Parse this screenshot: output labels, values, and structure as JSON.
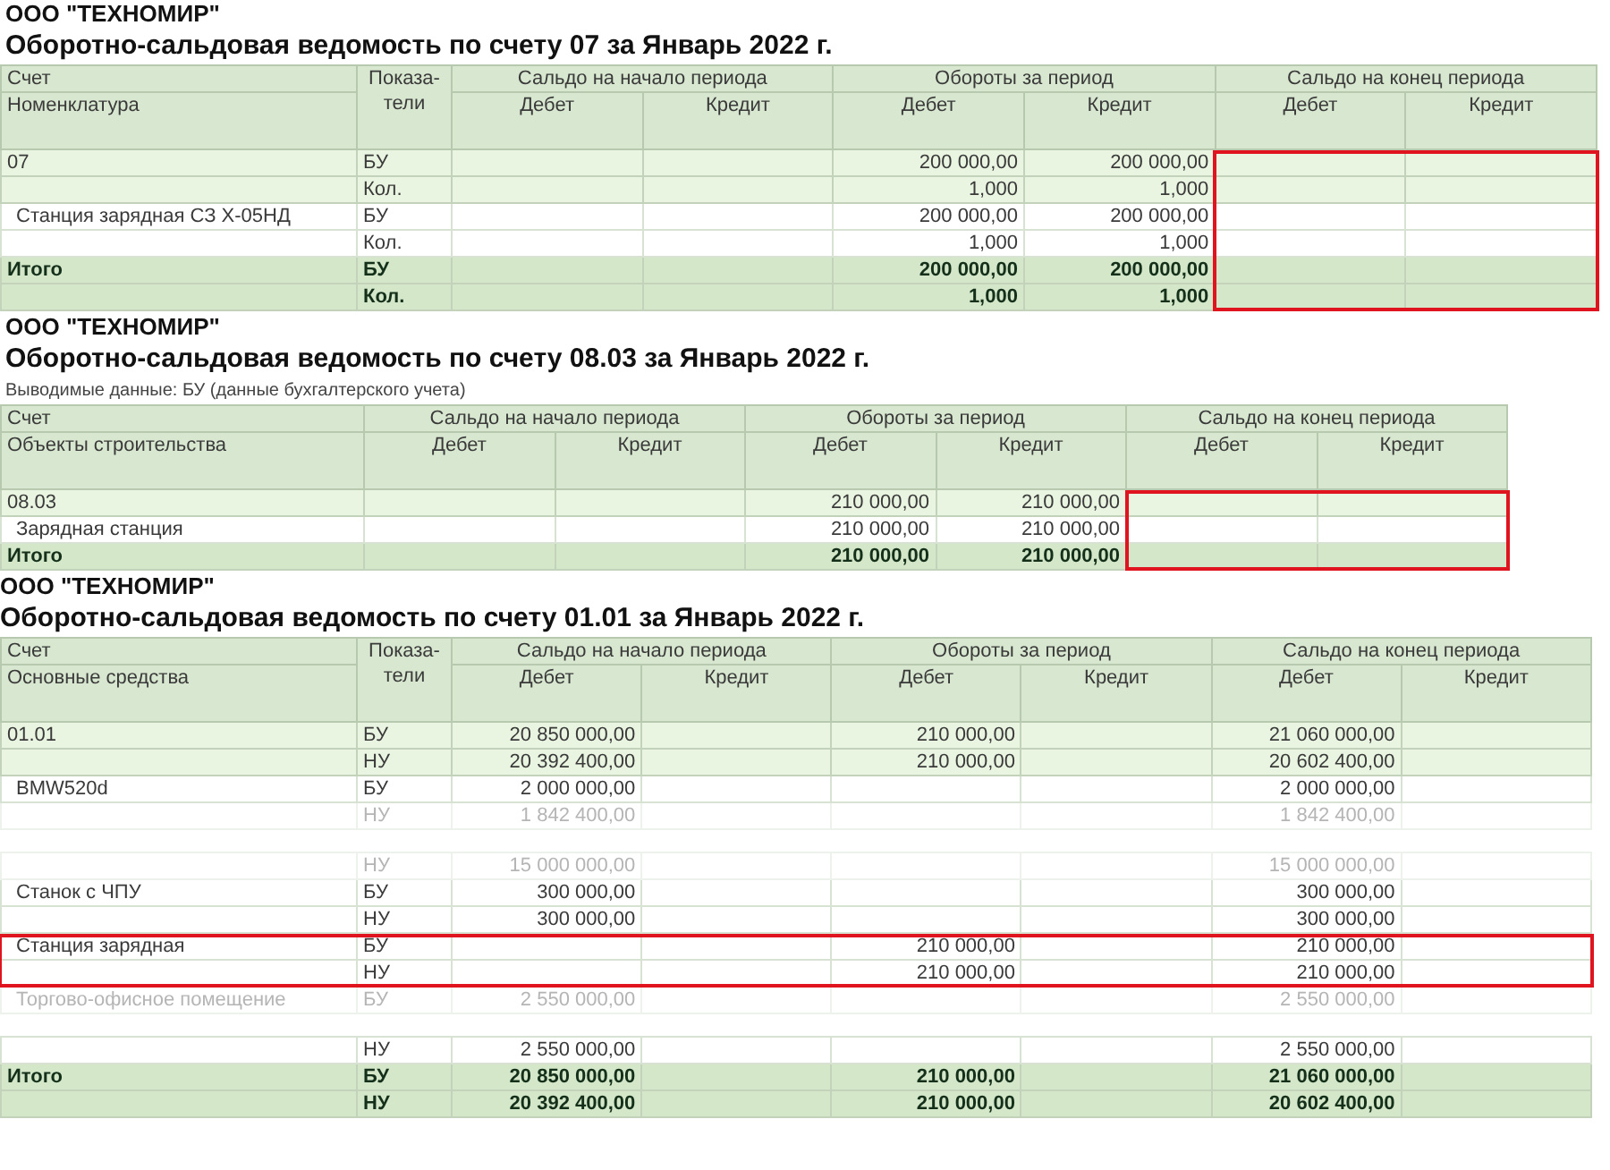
{
  "reports": [
    {
      "company": "ООО \"ТЕХНОМИР\"",
      "title": "Оборотно-сальдовая ведомость по счету 07 за Январь 2022 г.",
      "highlight_whole_rows": false,
      "columns": {
        "account": [
          "Счет",
          "Номенклатура"
        ],
        "indicator": "Показа-\nтели",
        "groups": [
          {
            "title": "Сальдо на начало периода",
            "columns": [
              "Дебет",
              "Кредит"
            ]
          },
          {
            "title": "Обороты за период",
            "columns": [
              "Дебет",
              "Кредит"
            ]
          },
          {
            "title": "Сальдо на конец периода",
            "columns": [
              "Дебет",
              "Кредит"
            ]
          }
        ]
      },
      "rows": [
        {
          "kind": "group",
          "name": "07",
          "indicator": "БУ",
          "values": {
            "turnover_debit": "200 000,00",
            "turnover_credit": "200 000,00"
          },
          "highlighted": true
        },
        {
          "kind": "group",
          "indicator": "Кол.",
          "values": {
            "turnover_debit": "1,000",
            "turnover_credit": "1,000"
          },
          "highlighted": true
        },
        {
          "kind": "item",
          "name": "Станция зарядная СЗ Х-05НД",
          "indicator": "БУ",
          "values": {
            "turnover_debit": "200 000,00",
            "turnover_credit": "200 000,00"
          },
          "highlighted": true
        },
        {
          "kind": "item",
          "indicator": "Кол.",
          "values": {
            "turnover_debit": "1,000",
            "turnover_credit": "1,000"
          },
          "highlighted": true
        },
        {
          "kind": "total",
          "name": "Итого",
          "indicator": "БУ",
          "values": {
            "turnover_debit": "200 000,00",
            "turnover_credit": "200 000,00"
          },
          "highlighted": true
        },
        {
          "kind": "total",
          "indicator": "Кол.",
          "values": {
            "turnover_debit": "1,000",
            "turnover_credit": "1,000"
          },
          "highlighted": true
        }
      ]
    },
    {
      "company": "ООО \"ТЕХНОМИР\"",
      "title": "Оборотно-сальдовая ведомость по счету 08.03 за Январь 2022 г.",
      "parameters": "Выводимые данные:  БУ (данные бухгалтерского учета)",
      "highlight_whole_rows": false,
      "columns": {
        "account": [
          "Счет",
          "Объекты строительства"
        ],
        "groups": [
          {
            "title": "Сальдо на начало периода",
            "columns": [
              "Дебет",
              "Кредит"
            ]
          },
          {
            "title": "Обороты за период",
            "columns": [
              "Дебет",
              "Кредит"
            ]
          },
          {
            "title": "Сальдо на конец периода",
            "columns": [
              "Дебет",
              "Кредит"
            ]
          }
        ]
      },
      "rows": [
        {
          "kind": "group",
          "name": "08.03",
          "values": {
            "turnover_debit": "210 000,00",
            "turnover_credit": "210 000,00"
          },
          "highlighted": true
        },
        {
          "kind": "item",
          "name": "Зарядная станция",
          "values": {
            "turnover_debit": "210 000,00",
            "turnover_credit": "210 000,00"
          },
          "highlighted": true
        },
        {
          "kind": "total",
          "name": "Итого",
          "values": {
            "turnover_debit": "210 000,00",
            "turnover_credit": "210 000,00"
          },
          "highlighted": true
        }
      ]
    },
    {
      "company": "ООО \"ТЕХНОМИР\"",
      "title": "Оборотно-сальдовая ведомость по счету 01.01 за Январь 2022 г.",
      "highlight_whole_rows": true,
      "columns": {
        "account": [
          "Счет",
          "Основные средства"
        ],
        "indicator": "Показа-\nтели",
        "groups": [
          {
            "title": "Сальдо на начало периода",
            "columns": [
              "Дебет",
              "Кредит"
            ]
          },
          {
            "title": "Обороты за период",
            "columns": [
              "Дебет",
              "Кредит"
            ]
          },
          {
            "title": "Сальдо на конец периода",
            "columns": [
              "Дебет",
              "Кредит"
            ]
          }
        ]
      },
      "rows": [
        {
          "kind": "group",
          "name": "01.01",
          "indicator": "БУ",
          "values": {
            "opening_debit": "20 850 000,00",
            "turnover_debit": "210 000,00",
            "closing_debit": "21 060 000,00"
          },
          "highlighted": false
        },
        {
          "kind": "group",
          "indicator": "НУ",
          "values": {
            "opening_debit": "20 392 400,00",
            "turnover_debit": "210 000,00",
            "closing_debit": "20 602 400,00"
          },
          "highlighted": false
        },
        {
          "kind": "item",
          "name": "BMW520d",
          "indicator": "БУ",
          "values": {
            "opening_debit": "2 000 000,00",
            "closing_debit": "2 000 000,00"
          },
          "highlighted": false
        },
        {
          "kind": "faded",
          "indicator": "НУ",
          "values": {
            "opening_debit": "1 842 400,00",
            "closing_debit": "1 842 400,00"
          },
          "highlighted": false
        },
        {
          "kind": "gap"
        },
        {
          "kind": "faded",
          "indicator": "НУ",
          "values": {
            "opening_debit": "15 000 000,00",
            "closing_debit": "15 000 000,00"
          },
          "highlighted": false
        },
        {
          "kind": "item",
          "name": "Станок с ЧПУ",
          "indicator": "БУ",
          "values": {
            "opening_debit": "300 000,00",
            "closing_debit": "300 000,00"
          },
          "highlighted": false
        },
        {
          "kind": "item",
          "indicator": "НУ",
          "values": {
            "opening_debit": "300 000,00",
            "closing_debit": "300 000,00"
          },
          "highlighted": false
        },
        {
          "kind": "item",
          "name": "Станция зарядная",
          "indicator": "БУ",
          "values": {
            "turnover_debit": "210 000,00",
            "closing_debit": "210 000,00"
          },
          "highlighted": true
        },
        {
          "kind": "item",
          "indicator": "НУ",
          "values": {
            "turnover_debit": "210 000,00",
            "closing_debit": "210 000,00"
          },
          "highlighted": true
        },
        {
          "kind": "faded",
          "name": "Торгово-офисное помещение",
          "indicator": "БУ",
          "values": {
            "opening_debit": "2 550 000,00",
            "closing_debit": "2 550 000,00"
          },
          "highlighted": false
        },
        {
          "kind": "gap"
        },
        {
          "kind": "item",
          "indicator": "НУ",
          "values": {
            "opening_debit": "2 550 000,00",
            "closing_debit": "2 550 000,00"
          },
          "highlighted": false
        },
        {
          "kind": "total",
          "name": "Итого",
          "indicator": "БУ",
          "values": {
            "opening_debit": "20 850 000,00",
            "turnover_debit": "210 000,00",
            "closing_debit": "21 060 000,00"
          },
          "highlighted": false
        },
        {
          "kind": "total",
          "indicator": "НУ",
          "values": {
            "opening_debit": "20 392 400,00",
            "turnover_debit": "210 000,00",
            "closing_debit": "20 602 400,00"
          },
          "highlighted": false
        }
      ]
    }
  ]
}
